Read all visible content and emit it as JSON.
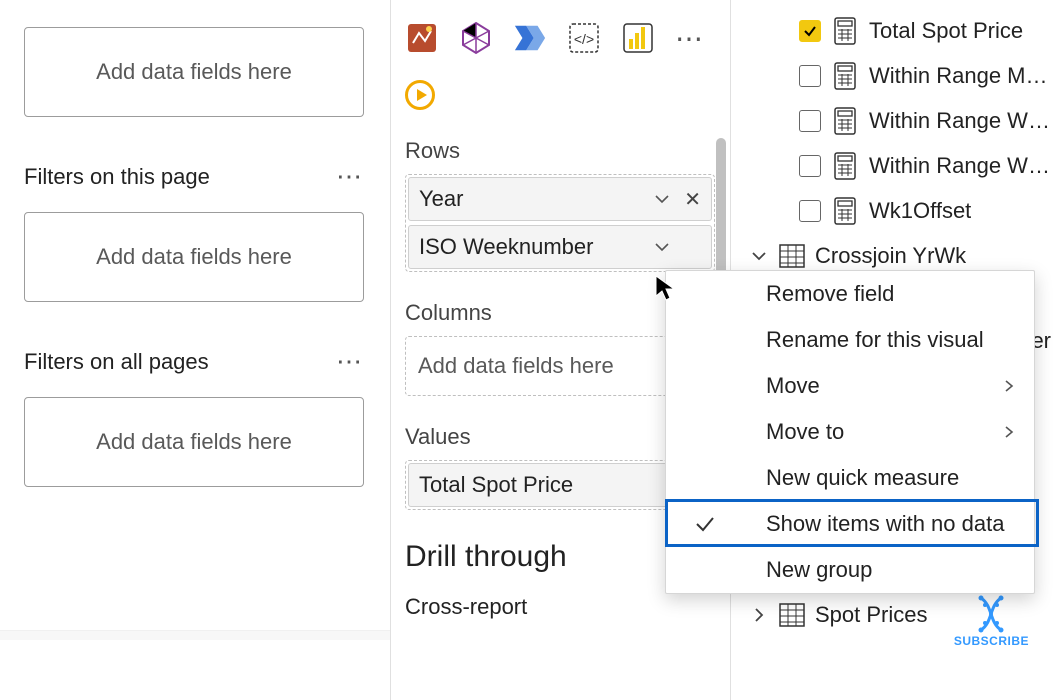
{
  "filters": {
    "add_text": "Add data fields here",
    "section_page": "Filters on this page",
    "section_all": "Filters on all pages"
  },
  "viz": {
    "sections": {
      "rows": "Rows",
      "columns": "Columns",
      "values": "Values",
      "drill": "Drill through",
      "cross": "Cross-report"
    },
    "rows_items": [
      "Year",
      "ISO Weeknumber"
    ],
    "values_item": "Total Spot Price",
    "add_text": "Add data fields here"
  },
  "fields": {
    "items": [
      {
        "checked": true,
        "label": "Total Spot Price"
      },
      {
        "checked": false,
        "label": "Within Range M…"
      },
      {
        "checked": false,
        "label": "Within Range W…"
      },
      {
        "checked": false,
        "label": "Within Range W…"
      },
      {
        "checked": false,
        "label": "Wk1Offset"
      }
    ],
    "tables": [
      {
        "expanded": true,
        "name": "Crossjoin YrWk"
      },
      {
        "name_suffix": "er"
      },
      {
        "expanded": false,
        "name": "Spot Prices"
      }
    ]
  },
  "context_menu": {
    "items": [
      {
        "label": "Remove field"
      },
      {
        "label": "Rename for this visual"
      },
      {
        "label": "Move",
        "submenu": true
      },
      {
        "label": "Move to",
        "submenu": true
      },
      {
        "label": "New quick measure"
      },
      {
        "label": "Show items with no data",
        "checked": true,
        "highlighted": true
      },
      {
        "label": "New group"
      }
    ]
  },
  "subscribe": {
    "text": "SUBSCRIBE"
  }
}
